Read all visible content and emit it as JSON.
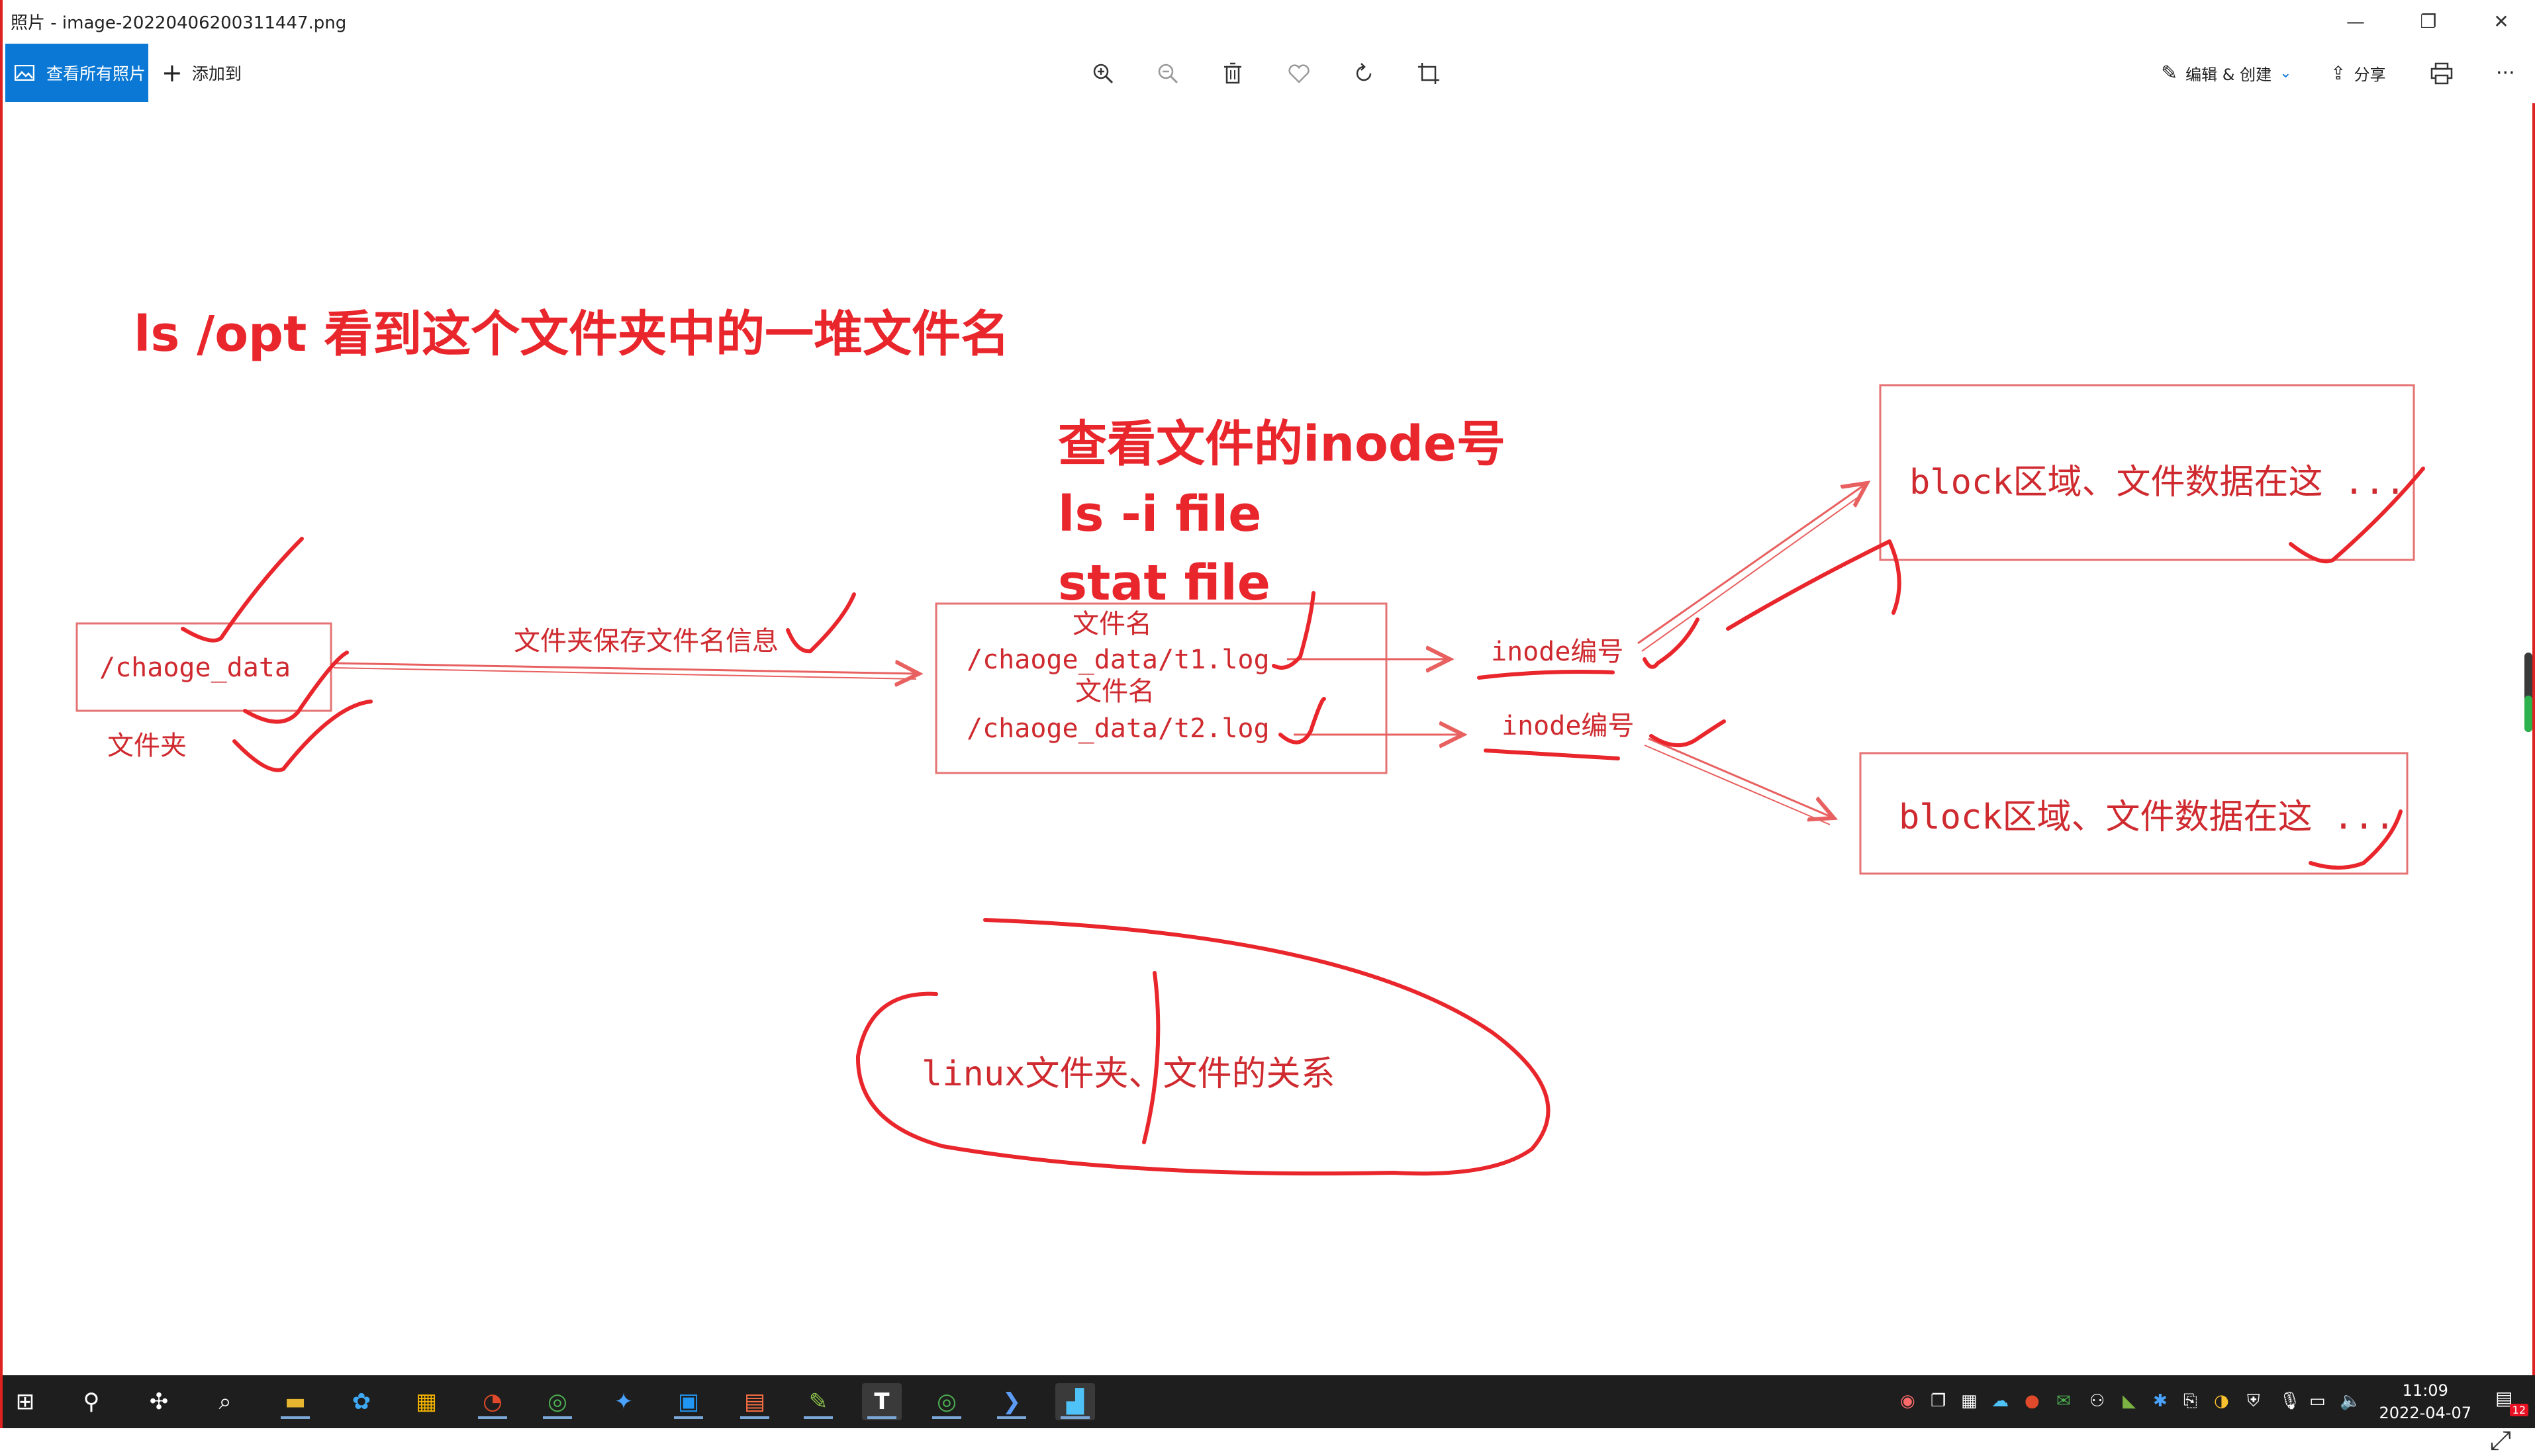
{
  "window": {
    "title": "照片 - image-20220406200311447.png",
    "minimize": "—",
    "maximize": "❐",
    "close": "✕"
  },
  "toolbar": {
    "view_all": "查看所有照片",
    "add_to": "添加到",
    "edit_create": "编辑 & 创建",
    "share": "分享",
    "more": "···"
  },
  "drawing": {
    "heading": "ls /opt  看到这个文件夹中的一堆文件名",
    "inode_title": "查看文件的inode号",
    "cmd1": "ls -i   file",
    "cmd2": "stat file",
    "folder": "/chaoge_data",
    "folder_caption": "文件夹",
    "arrow_label": "文件夹保存文件名信息",
    "file_label_1": "文件名",
    "file_path_1": "/chaoge_data/t1.log",
    "file_label_2": "文件名",
    "file_path_2": "/chaoge_data/t2.log",
    "inode_1": "inode编号",
    "inode_2": "inode编号",
    "block_1": "block区域、文件数据在这 ...",
    "block_2": "block区域、文件数据在这 ...",
    "relation": "linux文件夹、文件的关系",
    "ink_color": "#e8262c"
  },
  "taskbar": {
    "time": "11:09",
    "date": "2022-04-07",
    "notifications": "12"
  }
}
